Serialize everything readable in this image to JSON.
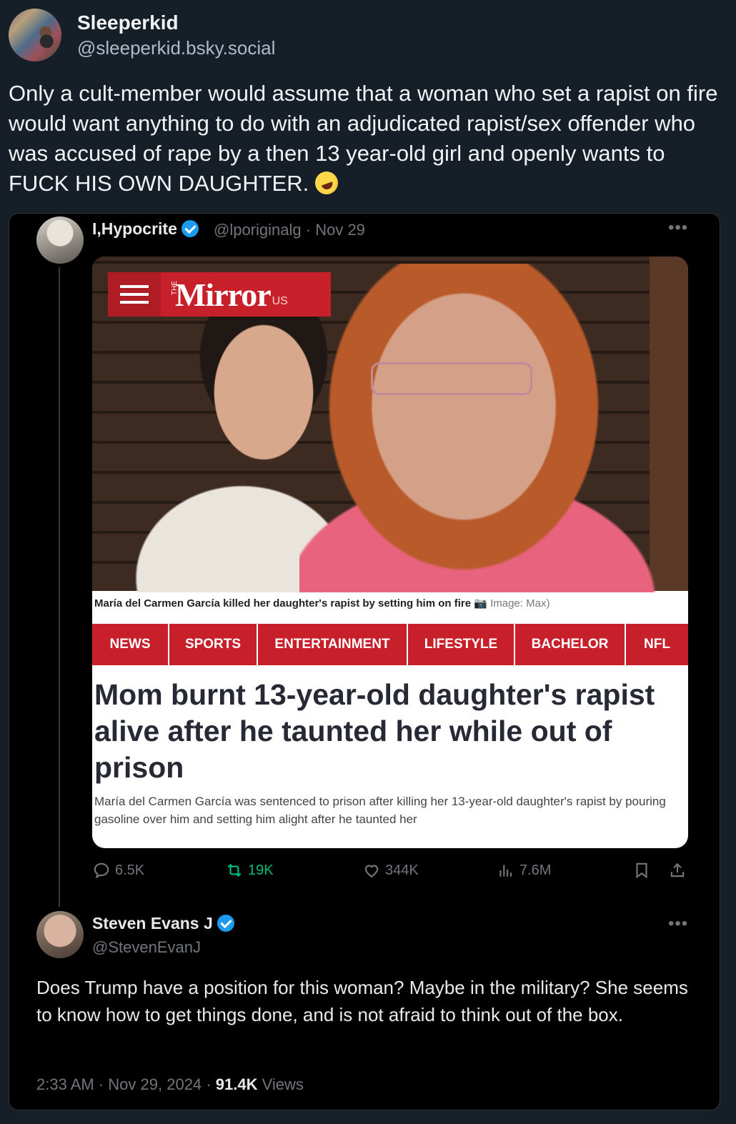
{
  "post": {
    "display_name": "Sleeperkid",
    "handle": "@sleeperkid.bsky.social",
    "text": "Only a cult-member would assume that a woman who set a rapist on fire would want anything to do with an adjudicated rapist/sex offender who was accused of rape by a then 13 year-old girl and openly wants to FUCK HIS OWN DAUGHTER.",
    "emoji": "rolling-on-floor-laughing-icon"
  },
  "embedded_tweet": {
    "display_name": "I,Hypocrite",
    "handle": "@lporiginalg",
    "date": "Nov 29",
    "article_card": {
      "logo_the": "THE",
      "logo_word": "Mirror",
      "logo_suffix": "US",
      "photo_caption": "María del Carmen García killed her daughter's rapist by setting him on fire",
      "photo_credit": "Image: Max)",
      "nav": [
        "NEWS",
        "SPORTS",
        "ENTERTAINMENT",
        "LIFESTYLE",
        "BACHELOR",
        "NFL"
      ],
      "headline": "Mom burnt 13-year-old daughter's rapist alive after he taunted her while out of prison",
      "standfirst": "María del Carmen García was sentenced to prison after killing her 13-year-old daughter's rapist by pouring gasoline over him and setting him alight after he taunted her",
      "accent": "#c8202a"
    },
    "stats": {
      "replies": "6.5K",
      "reposts": "19K",
      "likes": "344K",
      "views": "7.6M"
    }
  },
  "reply_tweet": {
    "display_name": "Steven Evans J",
    "handle": "@StevenEvanJ",
    "text": "Does Trump have a position for this woman? Maybe in the military? She seems to know how to get things done, and is not afraid to think out of the box.",
    "time": "2:33 AM",
    "date": "Nov 29, 2024",
    "views_count": "91.4K",
    "views_label": "Views"
  }
}
